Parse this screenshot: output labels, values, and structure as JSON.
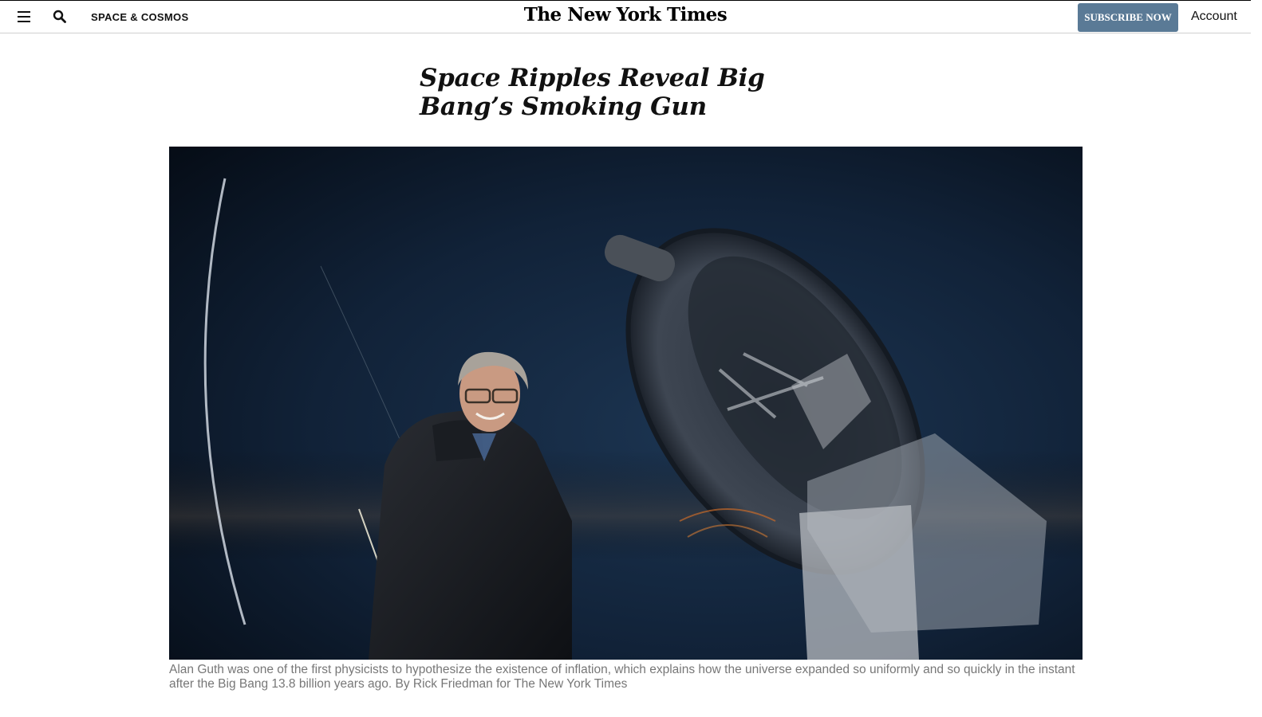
{
  "header": {
    "section": "SPACE & COSMOS",
    "masthead": "The New York Times",
    "subscribe_label": "SUBSCRIBE NOW",
    "account_label": "Account"
  },
  "article": {
    "headline": "Space Ripples Reveal Big Bang’s Smoking Gun",
    "caption": "Alan Guth was one of the first physicists to hypothesize the existence of inflation, which explains how the universe expanded so uniformly and so quickly in the instant after the Big Bang 13.8 billion years ago. By Rick Friedman for The New York Times"
  },
  "colors": {
    "subscribe_bg": "#5a7a96",
    "caption_text": "#777777",
    "sky_dark": "#0b1623"
  }
}
